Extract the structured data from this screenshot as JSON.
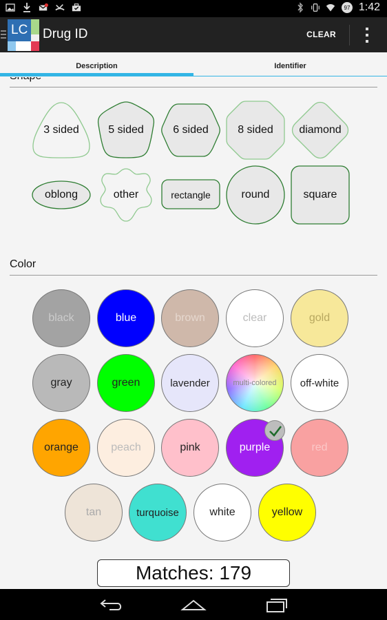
{
  "status_bar": {
    "time": "1:42",
    "battery_level": "97",
    "icons": [
      "picture-icon",
      "download-icon",
      "gmail-icon",
      "missed-call-icon",
      "briefcase-icon",
      "bluetooth-icon",
      "vibrate-icon",
      "wifi-icon",
      "battery-icon"
    ]
  },
  "action_bar": {
    "app_icon_text": "LC",
    "title": "Drug ID",
    "clear_label": "CLEAR"
  },
  "tabs": [
    {
      "label": "Description",
      "selected": true
    },
    {
      "label": "Identifier",
      "selected": false
    }
  ],
  "shape_section": {
    "label": "Shape",
    "items": [
      {
        "label": "3 sided",
        "selected": false
      },
      {
        "label": "5 sided",
        "selected": true
      },
      {
        "label": "6 sided",
        "selected": true
      },
      {
        "label": "8 sided",
        "selected": false
      },
      {
        "label": "diamond",
        "selected": false
      },
      {
        "label": "oblong",
        "selected": true
      },
      {
        "label": "other",
        "selected": false
      },
      {
        "label": "rectangle",
        "selected": true
      },
      {
        "label": "round",
        "selected": true
      },
      {
        "label": "square",
        "selected": true
      }
    ]
  },
  "color_section": {
    "label": "Color",
    "items": [
      {
        "label": "black",
        "fill": "#a3a3a3",
        "text_color": "#cccccc"
      },
      {
        "label": "blue",
        "fill": "#0000ff",
        "text_color": "#ffffff"
      },
      {
        "label": "brown",
        "fill": "#cfb8aa",
        "text_color": "#e6d8cf"
      },
      {
        "label": "clear",
        "fill": "#ffffff",
        "text_color": "#bbbbbb"
      },
      {
        "label": "gold",
        "fill": "#f7e89a",
        "text_color": "#b8a860"
      },
      {
        "label": "gray",
        "fill": "#b9b9b9",
        "text_color": "#222222"
      },
      {
        "label": "green",
        "fill": "#00ff00",
        "text_color": "#222222"
      },
      {
        "label": "lavender",
        "fill": "#e6e6fa",
        "text_color": "#222222"
      },
      {
        "label": "multi-colored",
        "fill": "rainbow",
        "text_color": "#888888"
      },
      {
        "label": "off-white",
        "fill": "#ffffff",
        "text_color": "#222222"
      },
      {
        "label": "orange",
        "fill": "#ffa500",
        "text_color": "#222222"
      },
      {
        "label": "peach",
        "fill": "#fdeee0",
        "text_color": "#bbbbbb"
      },
      {
        "label": "pink",
        "fill": "#ffc0cb",
        "text_color": "#222222"
      },
      {
        "label": "purple",
        "fill": "#a020f0",
        "text_color": "#ffffff",
        "selected": true
      },
      {
        "label": "red",
        "fill": "#f9a1a1",
        "text_color": "#fbc8c8"
      },
      {
        "label": "tan",
        "fill": "#eee4d8",
        "text_color": "#aaaaaa"
      },
      {
        "label": "turquoise",
        "fill": "#40e0d0",
        "text_color": "#222222"
      },
      {
        "label": "white",
        "fill": "#ffffff",
        "text_color": "#222222"
      },
      {
        "label": "yellow",
        "fill": "#ffff00",
        "text_color": "#222222"
      }
    ]
  },
  "matches": {
    "text": "Matches: 179"
  },
  "nav_bar": {
    "buttons": [
      "back-icon",
      "home-icon",
      "recent-apps-icon"
    ]
  },
  "colors": {
    "accent": "#33b5e5",
    "shape_stroke_selected": "#2e7d32",
    "shape_stroke_unselected": "#8fc98f"
  }
}
